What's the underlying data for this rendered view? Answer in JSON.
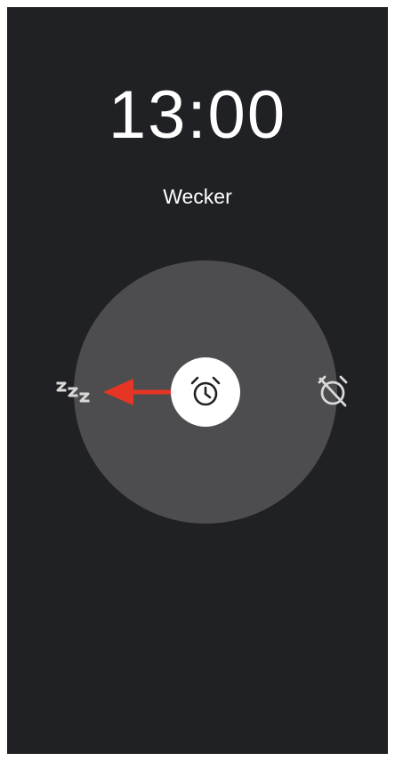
{
  "alarm": {
    "time": "13:00",
    "label": "Wecker"
  },
  "actions": {
    "snooze_icon": "snooze-zzz-icon",
    "alarm_icon": "alarm-clock-icon",
    "dismiss_icon": "alarm-off-icon"
  },
  "colors": {
    "background": "#202124",
    "ring": "#4d4d4f",
    "knob": "#ffffff",
    "arrow": "#e53524"
  }
}
